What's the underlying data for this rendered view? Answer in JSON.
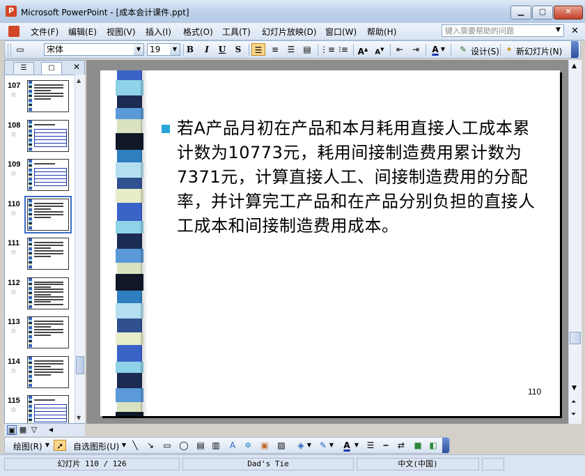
{
  "window": {
    "title": "Microsoft PowerPoint - [成本会计课件.ppt]",
    "app_icon_label": "P"
  },
  "menu": {
    "items": [
      "文件(F)",
      "编辑(E)",
      "视图(V)",
      "插入(I)",
      "格式(O)",
      "工具(T)",
      "幻灯片放映(D)",
      "窗口(W)",
      "帮助(H)"
    ],
    "help_placeholder": "键入需要帮助的问题"
  },
  "toolbar": {
    "font_name": "宋体",
    "font_size": "19",
    "bold": "B",
    "italic": "I",
    "underline": "U",
    "shadow": "S",
    "design_label": "设计(S)",
    "new_slide_label": "新幻灯片(N)"
  },
  "slides_pane": {
    "selected": "110",
    "items": [
      {
        "num": "107",
        "layout": "text"
      },
      {
        "num": "108",
        "layout": "table"
      },
      {
        "num": "109",
        "layout": "table"
      },
      {
        "num": "110",
        "layout": "text"
      },
      {
        "num": "111",
        "layout": "text"
      },
      {
        "num": "112",
        "layout": "dense"
      },
      {
        "num": "113",
        "layout": "text"
      },
      {
        "num": "114",
        "layout": "text"
      },
      {
        "num": "115",
        "layout": "table"
      }
    ]
  },
  "slide": {
    "body_text": "若A产品月初在产品和本月耗用直接人工成本累计数为10773元，耗用间接制造费用累计数为7371元，计算直接人工、间接制造费用的分配率，并计算完工产品和在产品分别负担的直接人工成本和间接制造费用成本。",
    "number": "110",
    "stripe_colors": [
      "#3a64c8",
      "#8fd3e8",
      "#1c2b52",
      "#5a9ad8",
      "#d9e3bf",
      "#101828",
      "#2f7fc0",
      "#b3dff0",
      "#30508f",
      "#e7ecc9"
    ]
  },
  "drawing_toolbar": {
    "draw_label": "绘图(R)",
    "autoshapes_label": "自选图形(U)"
  },
  "status": {
    "slide_position": "幻灯片 110 / 126",
    "design_template": "Dad's Tie",
    "language": "中文(中国)"
  }
}
